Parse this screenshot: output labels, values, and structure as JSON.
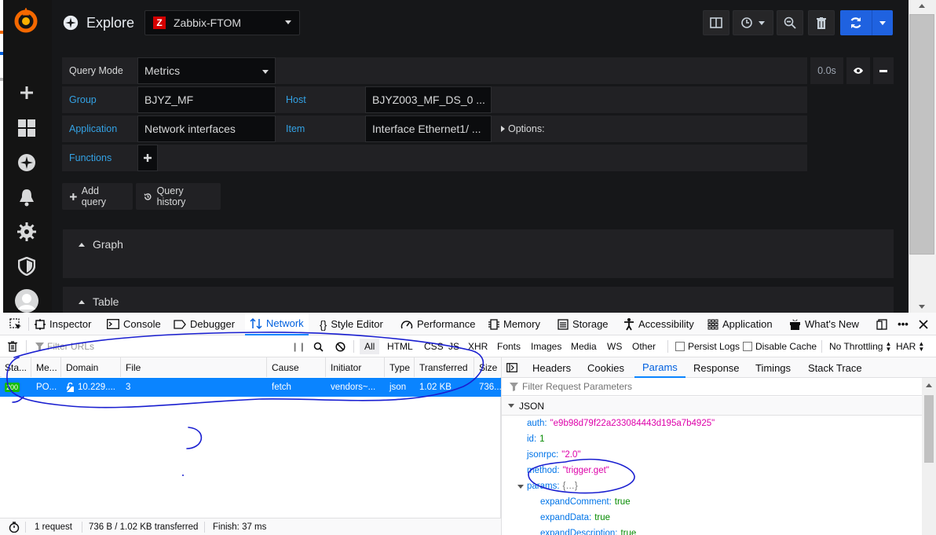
{
  "grafana": {
    "page_title": "Explore",
    "datasource": "Zabbix-FTOM",
    "datasource_logo": "Z",
    "query": {
      "mode_label": "Query Mode",
      "mode_value": "Metrics",
      "group_label": "Group",
      "group_value": "BJYZ_MF",
      "host_label": "Host",
      "host_value": "BJYZ003_MF_DS_0 ...",
      "application_label": "Application",
      "application_value": "Network interfaces",
      "item_label": "Item",
      "item_value": "Interface Ethernet1/ ...",
      "options_label": "Options:",
      "functions_label": "Functions",
      "duration": "0.0s"
    },
    "add_query_label": "Add query",
    "query_history_label": "Query history",
    "panels": [
      "Graph",
      "Table"
    ]
  },
  "devtools": {
    "tabs": [
      "Inspector",
      "Console",
      "Debugger",
      "Network",
      "Style Editor",
      "Performance",
      "Memory",
      "Storage",
      "Accessibility",
      "Application",
      "What's New"
    ],
    "selected_tab": "Network",
    "filter_placeholder": "Filter URLs",
    "type_filters": [
      "All",
      "HTML",
      "CSS",
      "JS",
      "XHR",
      "Fonts",
      "Images",
      "Media",
      "WS",
      "Other"
    ],
    "persist_logs_label": "Persist Logs",
    "disable_cache_label": "Disable Cache",
    "throttling_label": "No Throttling",
    "har_label": "HAR",
    "columns": [
      "Sta...",
      "Me...",
      "Domain",
      "File",
      "Cause",
      "Initiator",
      "Type",
      "Transferred",
      "Size"
    ],
    "request": {
      "status": "200",
      "method": "PO...",
      "domain": "10.229....",
      "file": "3",
      "cause": "fetch",
      "initiator": "vendors~...",
      "type": "json",
      "transferred": "1.02 KB",
      "size": "736..."
    },
    "status_bar": {
      "requests": "1 request",
      "transferred": "736 B / 1.02 KB transferred",
      "finish": "Finish: 37 ms"
    },
    "detail_tabs": [
      "Headers",
      "Cookies",
      "Params",
      "Response",
      "Timings",
      "Stack Trace"
    ],
    "selected_detail_tab": "Params",
    "params_filter_placeholder": "Filter Request Parameters",
    "json_header": "JSON",
    "json": {
      "auth_key": "auth:",
      "auth_val": "\"e9b98d79f22a233084443d195a7b4925\"",
      "id_key": "id:",
      "id_val": "1",
      "jsonrpc_key": "jsonrpc:",
      "jsonrpc_val": "\"2.0\"",
      "method_key": "method:",
      "method_val": "\"trigger.get\"",
      "params_key": "params:",
      "params_val": "{…}",
      "expandComment_key": "expandComment:",
      "expandComment_val": "true",
      "expandData_key": "expandData:",
      "expandData_val": "true",
      "expandDescription_key": "expandDescription:",
      "expandDescription_val": "true"
    }
  },
  "colors": {
    "grafana_bg": "#161719",
    "query_blue_label": "#33a2e5",
    "run_button": "#1f62e0",
    "devtools_selected": "#0a84ff",
    "status_ok": "#12bc00",
    "annotation_ink": "#1a1fd0"
  }
}
